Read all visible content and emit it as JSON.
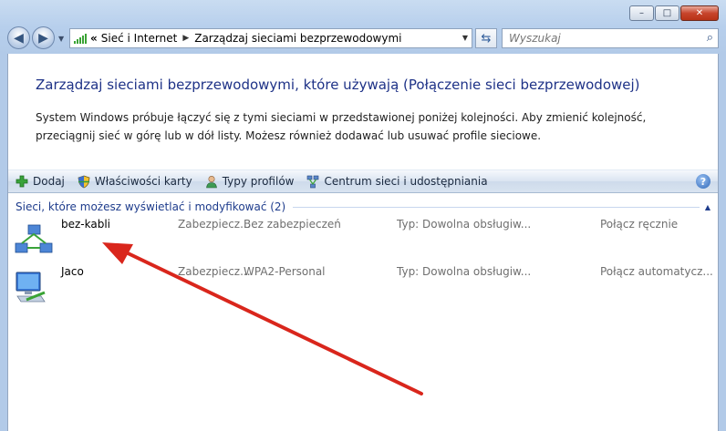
{
  "window": {
    "buttons": {
      "minimize": "–",
      "maximize": "□",
      "close": "✕"
    }
  },
  "nav": {
    "back": "◀",
    "forward": "▶",
    "overflow": "«",
    "breadcrumbs": [
      "Sieć i Internet",
      "Zarządzaj sieciami bezprzewodowymi"
    ],
    "search_placeholder": "Wyszukaj"
  },
  "main": {
    "heading": "Zarządzaj sieciami bezprzewodowymi, które używają (Połączenie sieci bezprzewodowej)",
    "description": "System Windows próbuje łączyć się z tymi sieciami w przedstawionej poniżej kolejności. Aby zmienić kolejność, przeciągnij sieć w górę lub w dół listy. Możesz również dodawać lub usuwać profile sieciowe."
  },
  "toolbar": {
    "add": "Dodaj",
    "adapter_properties": "Właściwości karty",
    "profile_types": "Typy profilów",
    "network_center": "Centrum sieci i udostępniania",
    "help": "?"
  },
  "list": {
    "group_header": "Sieci, które możesz wyświetlać i modyfikować (2)",
    "networks": [
      {
        "name": "bez-kabli",
        "security_label": "Zabezpiecz...",
        "security": "Bez zabezpieczeń",
        "type": "Typ:  Dowolna obsługiw...",
        "connect": "Połącz ręcznie"
      },
      {
        "name": "Jaco",
        "security_label": "Zabezpiecz...",
        "security": "WPA2-Personal",
        "type": "Typ:  Dowolna obsługiw...",
        "connect": "Połącz automatycz..."
      }
    ]
  },
  "colors": {
    "heading": "#1e3287",
    "annotation_arrow": "#d9261c"
  }
}
